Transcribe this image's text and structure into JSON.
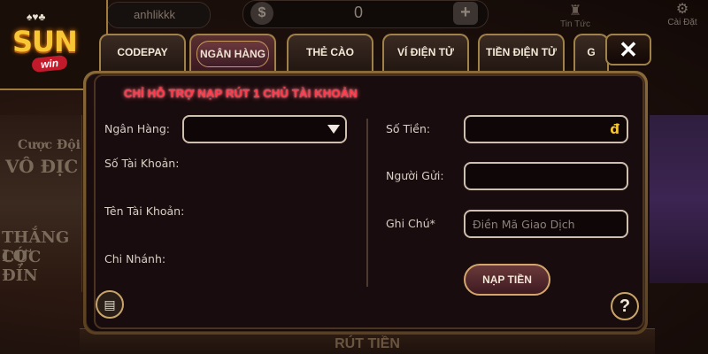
{
  "header": {
    "username": "anhlikkk",
    "balance": "0",
    "news_label": "Tin Tức",
    "settings_label": "Cài Đặt"
  },
  "background": {
    "left_card_lines": [
      "Cược Đội",
      "VÔ ĐỊC",
      "THẮNG LỚ",
      "CỰC ĐỈN"
    ],
    "bottom_text": "RÚT TIỀN"
  },
  "tabs": [
    {
      "label": "CODEPAY",
      "active": false
    },
    {
      "label": "NGÂN HÀNG",
      "active": true
    },
    {
      "label": "THẺ CÀO",
      "active": false
    },
    {
      "label": "VÍ ĐIỆN TỬ",
      "active": false
    },
    {
      "label": "TIỀN ĐIỆN TỬ",
      "active": false
    },
    {
      "label": "G",
      "active": false
    }
  ],
  "notice": "CHỈ HỖ TRỢ NẠP RÚT 1 CHỦ TÀI KHOẢN",
  "form": {
    "bank_label": "Ngân Hàng:",
    "bank_value": "",
    "account_number_label": "Số Tài Khoản:",
    "account_name_label": "Tên Tài Khoản:",
    "branch_label": "Chi Nhánh:",
    "amount_label": "Số Tiền:",
    "currency_symbol": "đ",
    "sender_label": "Người Gửi:",
    "note_label": "Ghi Chú*",
    "note_placeholder": "Điền Mã Giao Dịch",
    "submit_label": "NẠP TIỀN"
  },
  "colors": {
    "notice": "#ff3a4a",
    "gold_border": "#c9a56a",
    "currency": "#f7c72e"
  },
  "icons": {
    "close": "close-icon",
    "help": "help-icon",
    "history": "history-icon",
    "dropdown": "chevron-down-icon",
    "settings": "gear-icon",
    "news": "news-icon",
    "coin": "coin-icon",
    "add": "plus-icon"
  }
}
